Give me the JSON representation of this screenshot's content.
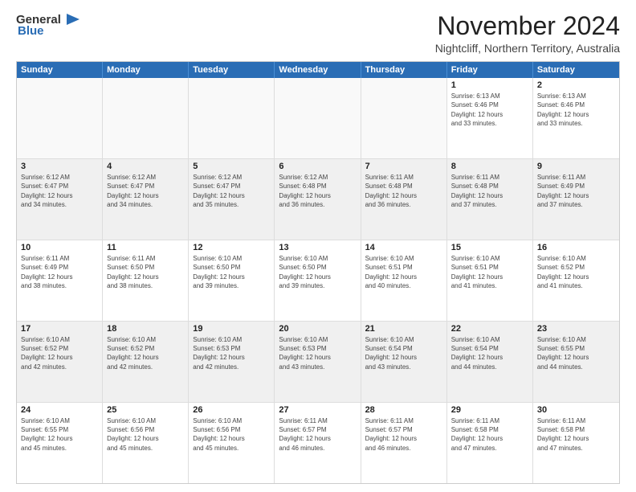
{
  "logo": {
    "line1": "General",
    "line2": "Blue",
    "icon": "▶"
  },
  "title": "November 2024",
  "subtitle": "Nightcliff, Northern Territory, Australia",
  "days_of_week": [
    "Sunday",
    "Monday",
    "Tuesday",
    "Wednesday",
    "Thursday",
    "Friday",
    "Saturday"
  ],
  "weeks": [
    [
      {
        "day": "",
        "info": ""
      },
      {
        "day": "",
        "info": ""
      },
      {
        "day": "",
        "info": ""
      },
      {
        "day": "",
        "info": ""
      },
      {
        "day": "",
        "info": ""
      },
      {
        "day": "1",
        "info": "Sunrise: 6:13 AM\nSunset: 6:46 PM\nDaylight: 12 hours\nand 33 minutes."
      },
      {
        "day": "2",
        "info": "Sunrise: 6:13 AM\nSunset: 6:46 PM\nDaylight: 12 hours\nand 33 minutes."
      }
    ],
    [
      {
        "day": "3",
        "info": "Sunrise: 6:12 AM\nSunset: 6:47 PM\nDaylight: 12 hours\nand 34 minutes."
      },
      {
        "day": "4",
        "info": "Sunrise: 6:12 AM\nSunset: 6:47 PM\nDaylight: 12 hours\nand 34 minutes."
      },
      {
        "day": "5",
        "info": "Sunrise: 6:12 AM\nSunset: 6:47 PM\nDaylight: 12 hours\nand 35 minutes."
      },
      {
        "day": "6",
        "info": "Sunrise: 6:12 AM\nSunset: 6:48 PM\nDaylight: 12 hours\nand 36 minutes."
      },
      {
        "day": "7",
        "info": "Sunrise: 6:11 AM\nSunset: 6:48 PM\nDaylight: 12 hours\nand 36 minutes."
      },
      {
        "day": "8",
        "info": "Sunrise: 6:11 AM\nSunset: 6:48 PM\nDaylight: 12 hours\nand 37 minutes."
      },
      {
        "day": "9",
        "info": "Sunrise: 6:11 AM\nSunset: 6:49 PM\nDaylight: 12 hours\nand 37 minutes."
      }
    ],
    [
      {
        "day": "10",
        "info": "Sunrise: 6:11 AM\nSunset: 6:49 PM\nDaylight: 12 hours\nand 38 minutes."
      },
      {
        "day": "11",
        "info": "Sunrise: 6:11 AM\nSunset: 6:50 PM\nDaylight: 12 hours\nand 38 minutes."
      },
      {
        "day": "12",
        "info": "Sunrise: 6:10 AM\nSunset: 6:50 PM\nDaylight: 12 hours\nand 39 minutes."
      },
      {
        "day": "13",
        "info": "Sunrise: 6:10 AM\nSunset: 6:50 PM\nDaylight: 12 hours\nand 39 minutes."
      },
      {
        "day": "14",
        "info": "Sunrise: 6:10 AM\nSunset: 6:51 PM\nDaylight: 12 hours\nand 40 minutes."
      },
      {
        "day": "15",
        "info": "Sunrise: 6:10 AM\nSunset: 6:51 PM\nDaylight: 12 hours\nand 41 minutes."
      },
      {
        "day": "16",
        "info": "Sunrise: 6:10 AM\nSunset: 6:52 PM\nDaylight: 12 hours\nand 41 minutes."
      }
    ],
    [
      {
        "day": "17",
        "info": "Sunrise: 6:10 AM\nSunset: 6:52 PM\nDaylight: 12 hours\nand 42 minutes."
      },
      {
        "day": "18",
        "info": "Sunrise: 6:10 AM\nSunset: 6:52 PM\nDaylight: 12 hours\nand 42 minutes."
      },
      {
        "day": "19",
        "info": "Sunrise: 6:10 AM\nSunset: 6:53 PM\nDaylight: 12 hours\nand 42 minutes."
      },
      {
        "day": "20",
        "info": "Sunrise: 6:10 AM\nSunset: 6:53 PM\nDaylight: 12 hours\nand 43 minutes."
      },
      {
        "day": "21",
        "info": "Sunrise: 6:10 AM\nSunset: 6:54 PM\nDaylight: 12 hours\nand 43 minutes."
      },
      {
        "day": "22",
        "info": "Sunrise: 6:10 AM\nSunset: 6:54 PM\nDaylight: 12 hours\nand 44 minutes."
      },
      {
        "day": "23",
        "info": "Sunrise: 6:10 AM\nSunset: 6:55 PM\nDaylight: 12 hours\nand 44 minutes."
      }
    ],
    [
      {
        "day": "24",
        "info": "Sunrise: 6:10 AM\nSunset: 6:55 PM\nDaylight: 12 hours\nand 45 minutes."
      },
      {
        "day": "25",
        "info": "Sunrise: 6:10 AM\nSunset: 6:56 PM\nDaylight: 12 hours\nand 45 minutes."
      },
      {
        "day": "26",
        "info": "Sunrise: 6:10 AM\nSunset: 6:56 PM\nDaylight: 12 hours\nand 45 minutes."
      },
      {
        "day": "27",
        "info": "Sunrise: 6:11 AM\nSunset: 6:57 PM\nDaylight: 12 hours\nand 46 minutes."
      },
      {
        "day": "28",
        "info": "Sunrise: 6:11 AM\nSunset: 6:57 PM\nDaylight: 12 hours\nand 46 minutes."
      },
      {
        "day": "29",
        "info": "Sunrise: 6:11 AM\nSunset: 6:58 PM\nDaylight: 12 hours\nand 47 minutes."
      },
      {
        "day": "30",
        "info": "Sunrise: 6:11 AM\nSunset: 6:58 PM\nDaylight: 12 hours\nand 47 minutes."
      }
    ]
  ]
}
